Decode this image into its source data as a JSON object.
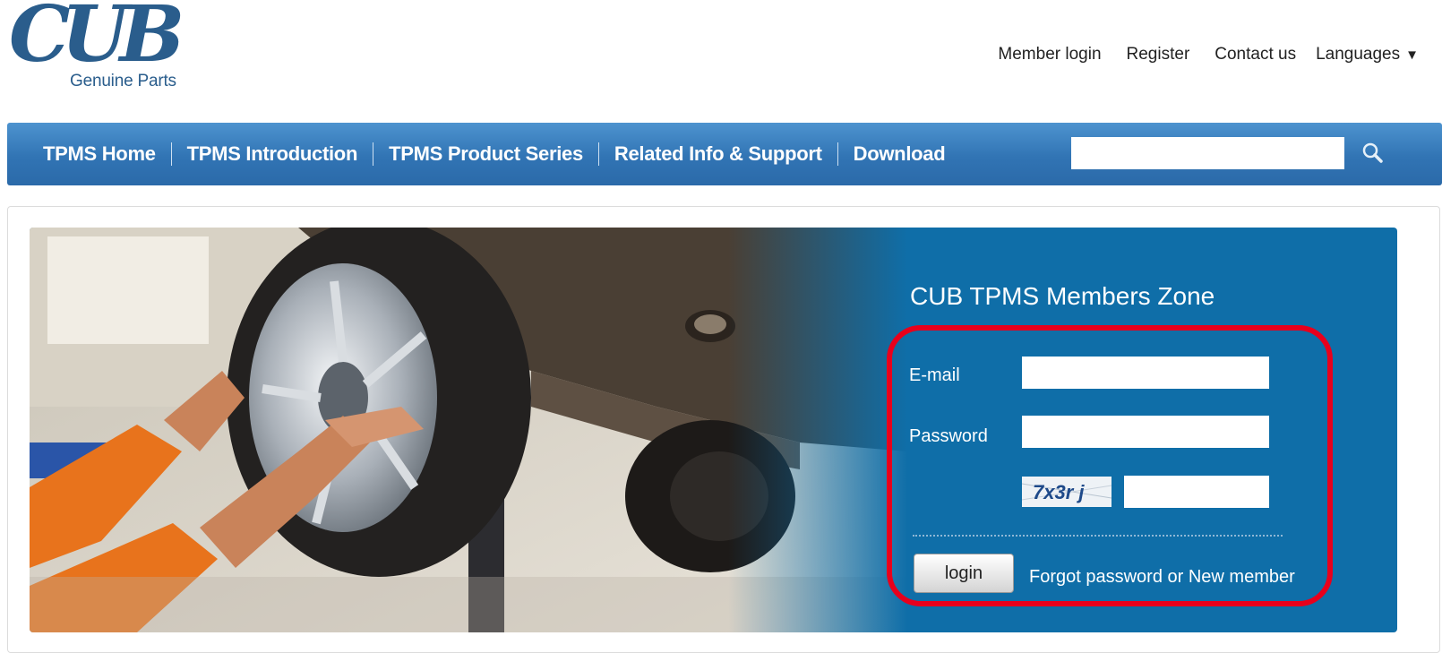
{
  "logo": {
    "brand": "CUB",
    "tagline": "Genuine Parts"
  },
  "topnav": {
    "member_login": "Member login",
    "register": "Register",
    "contact_us": "Contact us",
    "languages": "Languages"
  },
  "mainnav": {
    "items": [
      {
        "label": "TPMS Home"
      },
      {
        "label": "TPMS Introduction"
      },
      {
        "label": "TPMS Product Series"
      },
      {
        "label": "Related Info & Support"
      },
      {
        "label": "Download"
      }
    ],
    "search_value": ""
  },
  "login": {
    "title": "CUB TPMS Members Zone",
    "email_label": "E-mail",
    "email_value": "",
    "password_label": "Password",
    "password_value": "",
    "captcha_text": "7x3r j",
    "captcha_value": "",
    "button_label": "login",
    "forgot_link": "Forgot password or New member"
  },
  "colors": {
    "brand_blue": "#2a5d8c",
    "nav_blue": "#3174b4",
    "panel_blue": "#0f6ea8",
    "highlight_red": "#e8001c"
  }
}
